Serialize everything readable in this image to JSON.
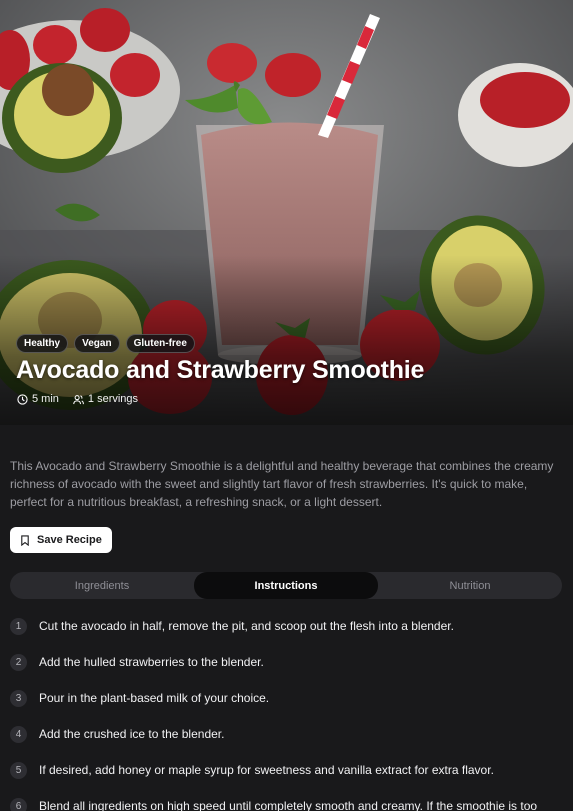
{
  "hero": {
    "tags": [
      "Healthy",
      "Vegan",
      "Gluten-free"
    ],
    "title": "Avocado and Strawberry Smoothie",
    "time": "5 min",
    "servings": "1 servings"
  },
  "description": "This Avocado and Strawberry Smoothie is a delightful and healthy beverage that combines the creamy richness of avocado with the sweet and slightly tart flavor of fresh strawberries. It's quick to make, perfect for a nutritious breakfast, a refreshing snack, or a light dessert.",
  "save_label": "Save Recipe",
  "tabs": [
    {
      "label": "Ingredients",
      "active": false
    },
    {
      "label": "Instructions",
      "active": true
    },
    {
      "label": "Nutrition",
      "active": false
    }
  ],
  "steps": [
    {
      "num": "1",
      "text": "Cut the avocado in half, remove the pit, and scoop out the flesh into a blender."
    },
    {
      "num": "2",
      "text": "Add the hulled strawberries to the blender."
    },
    {
      "num": "3",
      "text": "Pour in the plant-based milk of your choice."
    },
    {
      "num": "4",
      "text": "Add the crushed ice to the blender."
    },
    {
      "num": "5",
      "text": "If desired, add honey or maple syrup for sweetness and vanilla extract for extra flavor."
    },
    {
      "num": "6",
      "text": "Blend all ingredients on high speed until completely smooth and creamy. If the smoothie is too"
    }
  ],
  "icons": {
    "time": "clock-icon",
    "servings": "users-icon",
    "save": "bookmark-icon"
  },
  "colors": {
    "background": "#19191b",
    "accent_button": "#ffffff",
    "active_tab": "#0c0c0d"
  }
}
